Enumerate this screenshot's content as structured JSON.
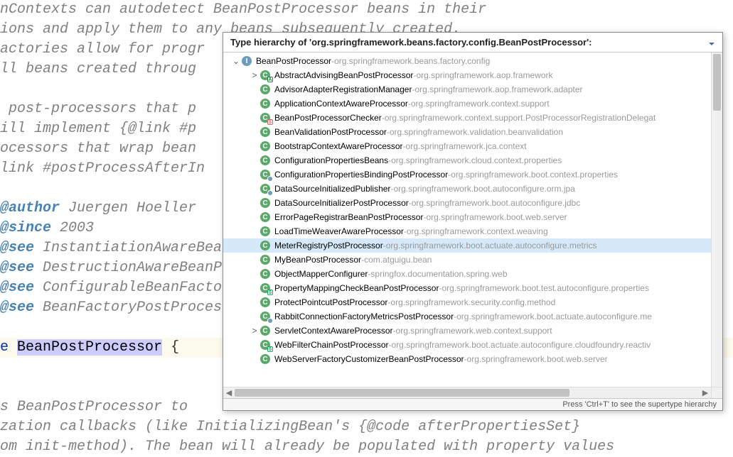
{
  "editor": {
    "lines": [
      {
        "pre": "",
        "comment": "nContexts can autodetect BeanPostProcessor beans in their"
      },
      {
        "pre": "",
        "comment": "ions and apply them to any beans subsequently created."
      },
      {
        "pre": "",
        "comment": "actories allow for progr"
      },
      {
        "pre": "",
        "comment": "ll beans created throug"
      },
      {
        "pre": "",
        "comment": ""
      },
      {
        "pre": "",
        "comment": " post-processors that p"
      },
      {
        "pre": "",
        "comment": "ill implement {@link #p"
      },
      {
        "pre": "",
        "comment": "ocessors that wrap bean"
      },
      {
        "pre": "",
        "comment": "link #postProcessAfterIn"
      },
      {
        "pre": "",
        "comment": ""
      },
      {
        "pre": "",
        "tag": "@author",
        "author": " Juergen Hoeller"
      },
      {
        "pre": "",
        "tag": "@since",
        "author": " 2003"
      },
      {
        "pre": "",
        "tag": "@see",
        "text": " InstantiationAwareBeanPostProce"
      },
      {
        "pre": "",
        "tag": "@see",
        "text": " DestructionAwareBeanPostProcess"
      },
      {
        "pre": "",
        "tag": "@see",
        "text": " ConfigurableBeanFactory#addBean"
      },
      {
        "pre": "",
        "tag": "@see",
        "text": " BeanFactoryPostProcessor"
      },
      {
        "pre": "",
        "comment": ""
      },
      {
        "decl": true,
        "kw": "public interface",
        "hl": "BeanPostProcessor",
        "rest": " {"
      },
      {
        "pre": "",
        "comment": ""
      },
      {
        "pre": "",
        "comment": ""
      },
      {
        "pre": "",
        "comment": "s BeanPostProcessor to "
      },
      {
        "pre": "",
        "comment": "zation callbacks (like InitializingBean's {@code afterPropertiesSet}"
      },
      {
        "pre": "",
        "comment": "om init-method). The bean will already be populated with property values"
      }
    ]
  },
  "popup": {
    "title": "Type hierarchy of 'org.springframework.beans.factory.config.BeanPostProcessor':",
    "footer": "Press 'Ctrl+T' to see the supertype hierarchy",
    "root": {
      "name": "BeanPostProcessor",
      "pkg": "org.springframework.beans.factory.config",
      "icon": "interface"
    },
    "items": [
      {
        "name": "AbstractAdvisingBeanPostProcessor",
        "pkg": "org.springframework.aop.framework",
        "icon": "class",
        "badge": "a",
        "expander": ">"
      },
      {
        "name": "AdvisorAdapterRegistrationManager",
        "pkg": "org.springframework.aop.framework.adapter",
        "icon": "class"
      },
      {
        "name": "ApplicationContextAwareProcessor",
        "pkg": "org.springframework.context.support",
        "icon": "class"
      },
      {
        "name": "BeanPostProcessorChecker",
        "pkg": "org.springframework.context.support.PostProcessorRegistrationDelegat",
        "icon": "class",
        "badge": "sf"
      },
      {
        "name": "BeanValidationPostProcessor",
        "pkg": "org.springframework.validation.beanvalidation",
        "icon": "class"
      },
      {
        "name": "BootstrapContextAwareProcessor",
        "pkg": "org.springframework.jca.context",
        "icon": "class"
      },
      {
        "name": "ConfigurationPropertiesBeans",
        "pkg": "org.springframework.cloud.context.properties",
        "icon": "class"
      },
      {
        "name": "ConfigurationPropertiesBindingPostProcessor",
        "pkg": "org.springframework.boot.context.properties",
        "icon": "class",
        "mark": true
      },
      {
        "name": "DataSourceInitializedPublisher",
        "pkg": "org.springframework.boot.autoconfigure.orm.jpa",
        "icon": "class",
        "mark": true
      },
      {
        "name": "DataSourceInitializerPostProcessor",
        "pkg": "org.springframework.boot.autoconfigure.jdbc",
        "icon": "class"
      },
      {
        "name": "ErrorPageRegistrarBeanPostProcessor",
        "pkg": "org.springframework.boot.web.server",
        "icon": "class"
      },
      {
        "name": "LoadTimeWeaverAwareProcessor",
        "pkg": "org.springframework.context.weaving",
        "icon": "class"
      },
      {
        "name": "MeterRegistryPostProcessor",
        "pkg": "org.springframework.boot.actuate.autoconfigure.metrics",
        "icon": "class",
        "selected": true
      },
      {
        "name": "MyBeanPostProcessor",
        "pkg": "com.atguigu.bean",
        "icon": "class"
      },
      {
        "name": "ObjectMapperConfigurer",
        "pkg": "springfox.documentation.spring.web",
        "icon": "class"
      },
      {
        "name": "PropertyMappingCheckBeanPostProcessor",
        "pkg": "org.springframework.boot.test.autoconfigure.properties",
        "icon": "class",
        "badge": "s",
        "mark": true
      },
      {
        "name": "ProtectPointcutPostProcessor",
        "pkg": "org.springframework.security.config.method",
        "icon": "class"
      },
      {
        "name": "RabbitConnectionFactoryMetricsPostProcessor",
        "pkg": "org.springframework.boot.actuate.autoconfigure.me",
        "icon": "class",
        "mark": true
      },
      {
        "name": "ServletContextAwareProcessor",
        "pkg": "org.springframework.web.context.support",
        "icon": "class",
        "expander": ">"
      },
      {
        "name": "WebFilterChainPostProcessor",
        "pkg": "org.springframework.boot.actuate.autoconfigure.cloudfoundry.reactiv",
        "icon": "class",
        "badge": "s",
        "mark": true
      },
      {
        "name": "WebServerFactoryCustomizerBeanPostProcessor",
        "pkg": "org.springframework.boot.web.server",
        "icon": "class"
      }
    ]
  }
}
